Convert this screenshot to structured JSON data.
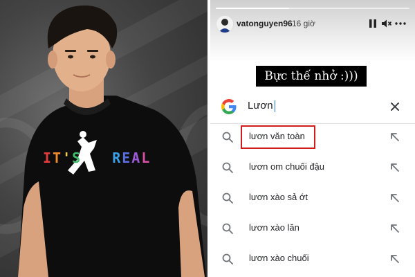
{
  "left_photo": {
    "shirt_print": "IT'S REAL",
    "shirt_letters": [
      "I",
      "T",
      "'",
      "S",
      " ",
      "R",
      "E",
      "A",
      "L"
    ],
    "shirt_letter_colors": [
      "#e23b3b",
      "#f18a2a",
      "#f4d03f",
      "#3fbf6b",
      "#ffffff",
      "#3aa0e8",
      "#5b6fe0",
      "#9b59d6",
      "#d94fa5"
    ],
    "background_color": "#3a3a3a",
    "shirt_color": "#0d0d0d"
  },
  "story": {
    "username": "vatonguyen96",
    "time_ago": "16 giờ",
    "progress": 0.38,
    "controls": [
      "pause-icon",
      "mute-icon",
      "more-icon"
    ],
    "caption": "Bực thế nhở :)))"
  },
  "search": {
    "query": "Lươn",
    "icons": [
      "google-logo-icon",
      "clear-icon"
    ],
    "suggestions": [
      {
        "text": "lươn văn toàn",
        "highlighted": true
      },
      {
        "text": "lươn om chuối đậu",
        "highlighted": false
      },
      {
        "text": "lươn xào sả ớt",
        "highlighted": false
      },
      {
        "text": "lươn xào lăn",
        "highlighted": false
      },
      {
        "text": "lươn xào chuối",
        "highlighted": false
      }
    ],
    "highlight_color": "#d21c1c"
  }
}
